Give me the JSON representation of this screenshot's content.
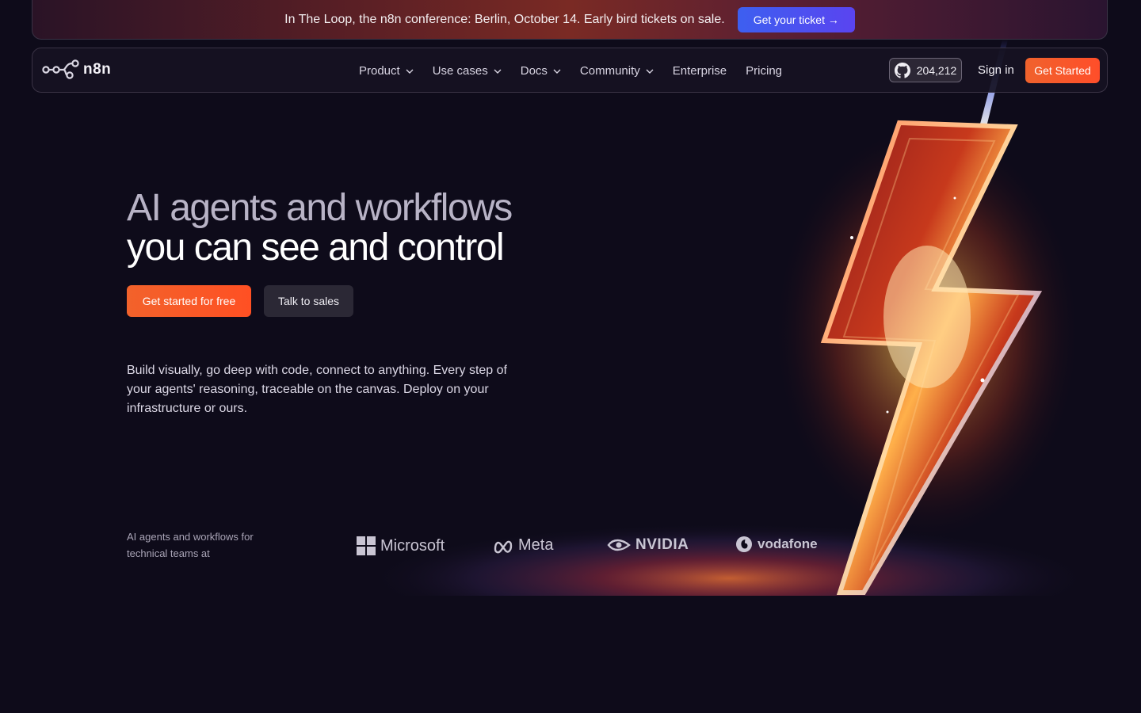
{
  "announcement": {
    "text": "In The Loop, the n8n conference: Berlin, October 14. Early bird tickets on sale.",
    "button_label": "Get your ticket →"
  },
  "nav": {
    "brand": "n8n",
    "links": [
      {
        "label": "Product",
        "has_dropdown": true
      },
      {
        "label": "Use cases",
        "has_dropdown": true
      },
      {
        "label": "Docs",
        "has_dropdown": true
      },
      {
        "label": "Community",
        "has_dropdown": true
      },
      {
        "label": "Enterprise",
        "has_dropdown": false
      },
      {
        "label": "Pricing",
        "has_dropdown": false
      }
    ],
    "github_stars": "204,212",
    "sign_in": "Sign in",
    "get_started": "Get Started"
  },
  "hero": {
    "title_line1": "AI agents and workflows",
    "title_line2": "you can see and control",
    "cta_primary": "Get started for free",
    "cta_secondary": "Talk to sales",
    "description": "Build visually, go deep with code, connect to anything. Every step of your agents' reasoning, traceable on the canvas. Deploy on your infrastructure or ours."
  },
  "logos": {
    "caption": "AI agents and workflows for technical teams at",
    "brands": [
      "Microsoft",
      "Meta",
      "NVIDIA",
      "vodafone"
    ]
  },
  "colors": {
    "background": "#0e0b1a",
    "accent_orange": "#ff5023",
    "ticket_button": "#4a52f0"
  }
}
